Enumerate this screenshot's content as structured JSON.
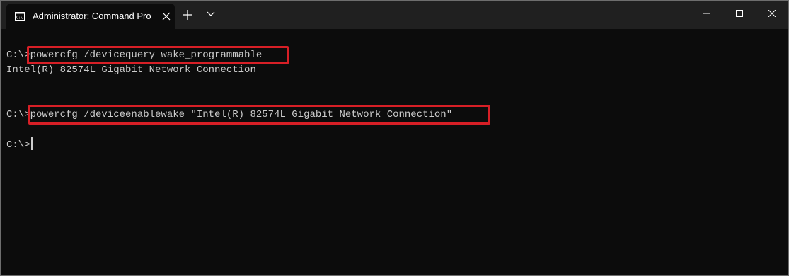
{
  "window": {
    "tab_title": "Administrator: Command Prompt",
    "tab_icon": "cmd-icon",
    "controls": [
      "minimize-icon",
      "maximize-icon",
      "close-icon"
    ]
  },
  "terminal": {
    "lines": [
      {
        "prompt": "C:\\>",
        "command": "powercfg /devicequery wake_programmable"
      },
      {
        "output": "Intel(R) 82574L Gigabit Network Connection"
      },
      {
        "prompt": "C:\\>",
        "command": "powercfg /deviceenablewake \"Intel(R) 82574L Gigabit Network Connection\""
      },
      {
        "prompt": "C:\\>",
        "command": ""
      }
    ],
    "highlight_color": "#d71f26",
    "text_color": "#cccccc",
    "background": "#0c0c0c"
  }
}
